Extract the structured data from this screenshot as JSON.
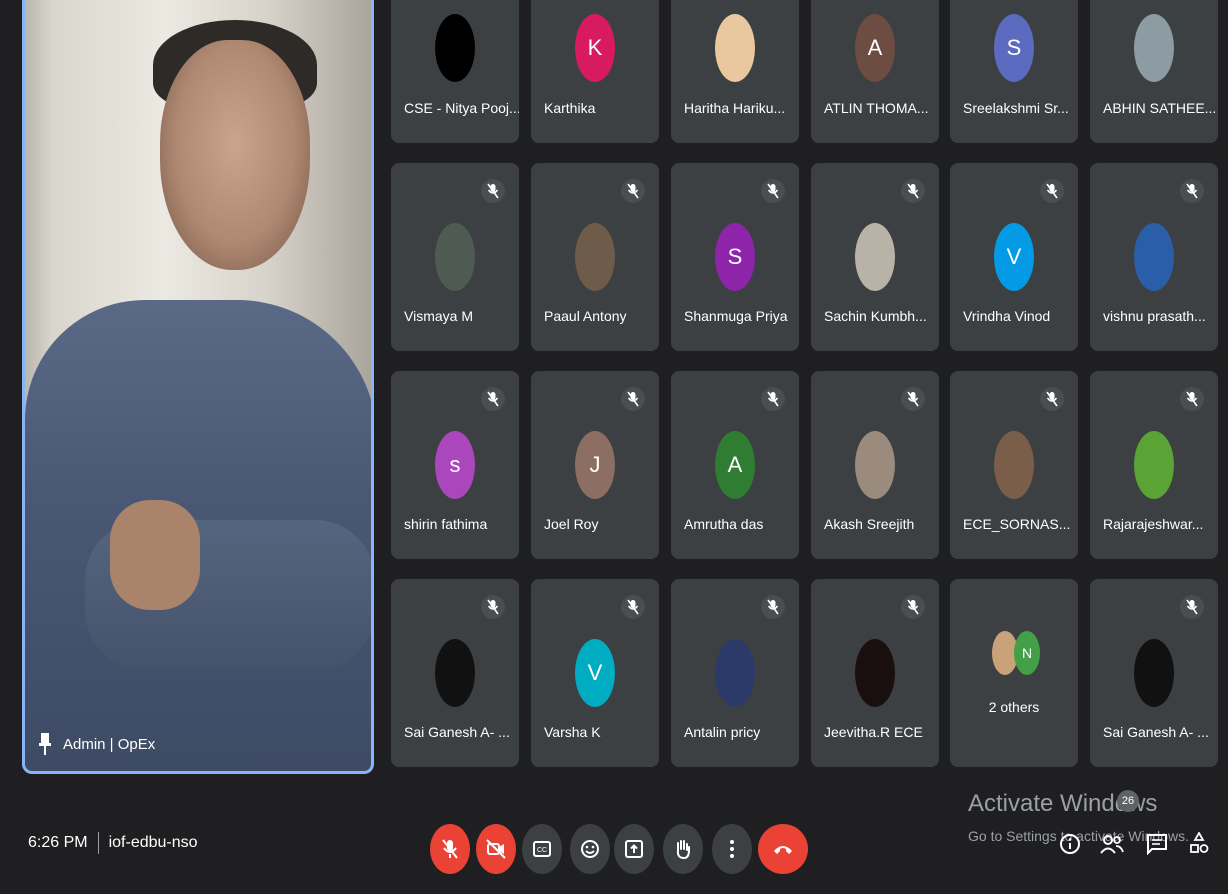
{
  "pinned": {
    "name": "Admin | OpEx"
  },
  "tiles": [
    {
      "name": "CSE - Nitya Pooj...",
      "avatar_letter": "",
      "avatar_color": "#000000",
      "muted": false
    },
    {
      "name": "Karthika",
      "avatar_letter": "K",
      "avatar_color": "#d81b60",
      "muted": false
    },
    {
      "name": "Haritha Hariku...",
      "avatar_letter": "",
      "avatar_color": "#e9c8a0",
      "muted": false
    },
    {
      "name": "ATLIN THOMA...",
      "avatar_letter": "A",
      "avatar_color": "#6d4c41",
      "muted": false
    },
    {
      "name": "Sreelakshmi Sr...",
      "avatar_letter": "S",
      "avatar_color": "#5c6bc0",
      "muted": false
    },
    {
      "name": "ABHIN SATHEE...",
      "avatar_letter": "",
      "avatar_color": "#8d9ba3",
      "muted": false
    },
    {
      "name": "Vismaya M",
      "avatar_letter": "",
      "avatar_color": "#4e5a52",
      "muted": true
    },
    {
      "name": "Paaul Antony",
      "avatar_letter": "",
      "avatar_color": "#6e5b4a",
      "muted": true
    },
    {
      "name": "Shanmuga Priya",
      "avatar_letter": "S",
      "avatar_color": "#8e24aa",
      "muted": true
    },
    {
      "name": "Sachin Kumbh...",
      "avatar_letter": "",
      "avatar_color": "#b8b3a6",
      "muted": true
    },
    {
      "name": "Vrindha Vinod",
      "avatar_letter": "V",
      "avatar_color": "#039be5",
      "muted": true
    },
    {
      "name": "vishnu prasath...",
      "avatar_letter": "",
      "avatar_color": "#2b5ea8",
      "muted": true
    },
    {
      "name": "shirin fathima",
      "avatar_letter": "s",
      "avatar_color": "#ab47bc",
      "muted": true
    },
    {
      "name": "Joel Roy",
      "avatar_letter": "J",
      "avatar_color": "#8d6e63",
      "muted": true
    },
    {
      "name": "Amrutha das",
      "avatar_letter": "A",
      "avatar_color": "#2e7d32",
      "muted": true
    },
    {
      "name": "Akash Sreejith",
      "avatar_letter": "",
      "avatar_color": "#9a8b7c",
      "muted": true
    },
    {
      "name": "ECE_SORNAS...",
      "avatar_letter": "",
      "avatar_color": "#7a5e4a",
      "muted": true
    },
    {
      "name": "Rajarajeshwar...",
      "avatar_letter": "",
      "avatar_color": "#5aa334",
      "muted": true
    },
    {
      "name": "Sai Ganesh A- ...",
      "avatar_letter": "",
      "avatar_color": "#111111",
      "muted": true
    },
    {
      "name": "Varsha K",
      "avatar_letter": "V",
      "avatar_color": "#00acc1",
      "muted": true
    },
    {
      "name": "Antalin pricy",
      "avatar_letter": "",
      "avatar_color": "#2c3a6a",
      "muted": true
    },
    {
      "name": "Jeevitha.R ECE",
      "avatar_letter": "",
      "avatar_color": "#1a0f0f",
      "muted": true
    },
    {
      "name": "2 others",
      "avatar_letter": "N",
      "avatar_color": "#43a047",
      "muted": false
    },
    {
      "name": "Sai Ganesh A- ...",
      "avatar_letter": "",
      "avatar_color": "#111111",
      "muted": true
    }
  ],
  "bottom": {
    "time": "6:26 PM",
    "meeting_code": "iof-edbu-nso",
    "participants_count": "26"
  },
  "watermark": {
    "title": "Activate Windows",
    "subtitle": "Go to Settings to activate Windows."
  }
}
